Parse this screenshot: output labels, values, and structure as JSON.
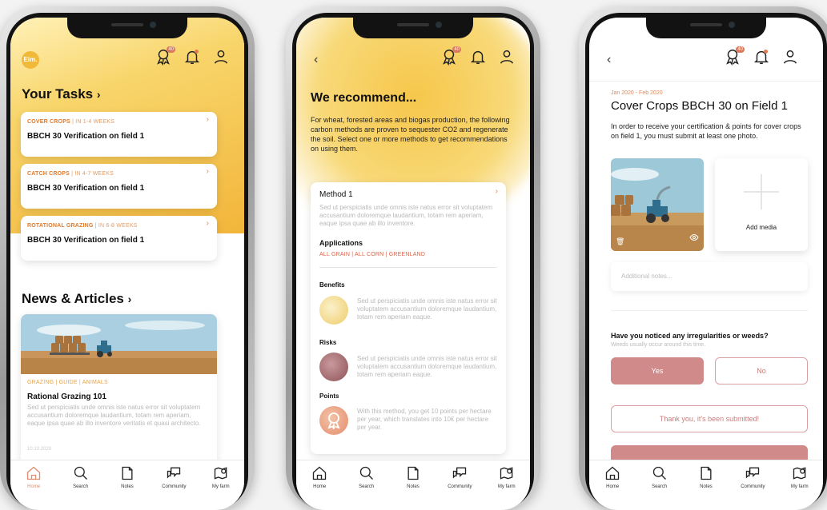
{
  "phone1": {
    "logo": "Eim.",
    "badge": "40",
    "title": "Your Tasks",
    "tasks": [
      {
        "tag": "COVER CROPS",
        "when": "IN 1-4 WEEKS",
        "title": "BBCH 30 Verification on field 1"
      },
      {
        "tag": "CATCH CROPS",
        "when": "IN 4-7 WEEKS",
        "title": "BBCH 30 Verification on field 1"
      },
      {
        "tag": "ROTATIONAL GRAZING",
        "when": "IN 6-8 WEEKS",
        "title": "BBCH 30 Verification on field 1"
      }
    ],
    "news_title": "News & Articles",
    "article": {
      "tags": [
        "GRAZING",
        "GUIDE",
        "ANIMALS"
      ],
      "title": "Rational Grazing 101",
      "body": "Sed ut perspiciatis unde omnis iste natus error sit voluptatem accusantium doloremque laudantium, totam rem aperiam, eaque ipsa quae ab illo inventore veritatis et quasi architecto.",
      "date": "10.10.2020"
    }
  },
  "phone2": {
    "badge": "40",
    "title": "We recommend...",
    "intro": "For wheat, forested areas and biogas production, the following carbon methods are proven to sequester CO2 and regenerate the soil. Select one or more methods to get recommendations on using them.",
    "method": {
      "title": "Method 1",
      "body": "Sed ut perspiciatis unde omnis iste natus error sit voluptatem accusantium doloremque laudantium, totam rem aperiam, eaque ipsa quae ab illo inventore.",
      "applications_label": "Applications",
      "applications": [
        "ALL GRAIN",
        "ALL CORN",
        "GREENLAND"
      ],
      "benefits_label": "Benefits",
      "benefits_text": "Sed ut perspiciatis unde omnis iste natus error sit voluptatem accusantium doloremque laudantium, totam rem aperiam eaque.",
      "risks_label": "Risks",
      "risks_text": "Sed ut perspiciatis unde omnis iste natus error sit voluptatem accusantium doloremque laudantium, totam rem aperiam eaque.",
      "points_label": "Points",
      "points_text": "With this method, you get 10 points per hectare per year, which translates into 10€ per hectare per year."
    }
  },
  "phone3": {
    "badge": "40",
    "date": "Jan 2020 - Feb 2020",
    "title": "Cover Crops BBCH 30 on Field 1",
    "intro": "In order to receive your certification & points for cover crops on field 1, you must submit at least one photo.",
    "add_media": "Add media",
    "notes_placeholder": "Additional notes...",
    "question": "Have you noticed any irregularities or weeds?",
    "question_sub": "Weeds usually occur around this time.",
    "yes": "Yes",
    "no": "No",
    "submitted": "Thank you, it's been submitted!"
  },
  "tabs": [
    "Home",
    "Search",
    "Notes",
    "Community",
    "My farm"
  ],
  "colors": {
    "accent": "#e08a5a",
    "pink": "#c97e7e",
    "yellow": "#f3c64a"
  }
}
